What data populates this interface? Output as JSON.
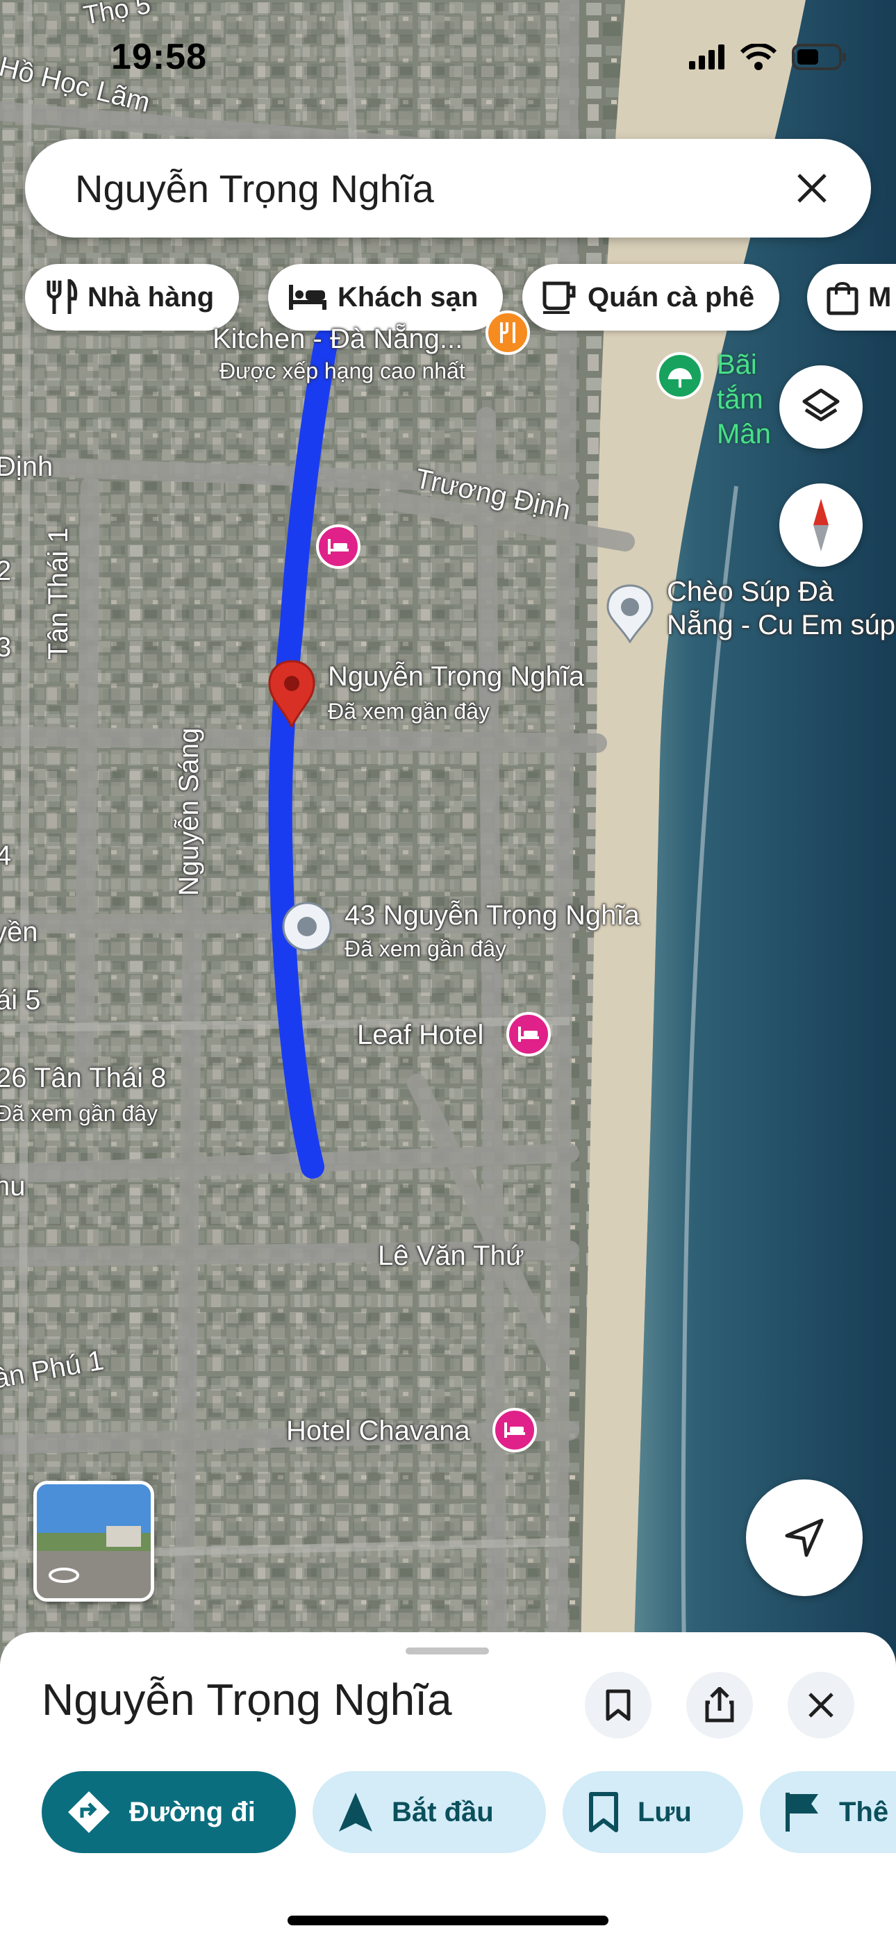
{
  "status_bar": {
    "time": "19:58"
  },
  "search": {
    "value": "Nguyễn Trọng Nghĩa",
    "clear_icon": "close-icon"
  },
  "chips": [
    {
      "label": "Nhà hàng",
      "icon": "restaurant-icon"
    },
    {
      "label": "Khách sạn",
      "icon": "hotel-icon"
    },
    {
      "label": "Quán cà phê",
      "icon": "coffee-icon"
    },
    {
      "label": "M",
      "icon": "shopping-bag-icon"
    }
  ],
  "map": {
    "street_labels": [
      "Trương Định",
      "Tân Thái 1",
      "Nguyễn Sáng",
      "Lê Văn Thứ",
      "26 Tân Thái 8",
      "Hồ Học Lãm",
      "Thọ 5",
      "Định",
      "yền",
      "ái 5",
      "hu",
      "ân Phú 1",
      "4",
      "3",
      "2"
    ],
    "places": [
      {
        "name": "Kitchen - Đà Nẵng...",
        "sub": "Được xếp hạng cao nhất",
        "icon": "restaurant-pin-icon"
      },
      {
        "name": "Bãi tắm Mân",
        "icon": "beach-pin-icon"
      },
      {
        "name": "Chèo Súp Đà Nẵng - Cu Em súp",
        "icon": "place-pin-icon"
      },
      {
        "name": "Nguyễn Trọng Nghĩa",
        "sub": "Đã xem gần đây",
        "icon": "red-location-pin-icon"
      },
      {
        "name": "43 Nguyễn Trọng Nghĩa",
        "sub": "Đã xem gần đây",
        "icon": "recent-place-pin-icon"
      },
      {
        "name": "Leaf Hotel",
        "icon": "hotel-pin-icon"
      },
      {
        "name": "Hotel Chavana",
        "icon": "hotel-pin-icon"
      },
      {
        "name": "",
        "sub": "Đã xem gần đây",
        "icon": "none"
      }
    ],
    "route_color": "#1a3cf0",
    "water_color": "#1e4a63",
    "sand_color": "#d8cfb8"
  },
  "sheet": {
    "title": "Nguyễn Trọng Nghĩa",
    "actions": [
      {
        "label": "Đường đi",
        "style": "primary",
        "icon": "directions-icon"
      },
      {
        "label": "Bắt đầu",
        "style": "secondary",
        "icon": "navigation-arrow-icon"
      },
      {
        "label": "Lưu",
        "style": "secondary",
        "icon": "bookmark-icon"
      },
      {
        "label": "Thê",
        "style": "secondary",
        "icon": "flag-icon"
      }
    ]
  },
  "colors": {
    "primary": "#0b6e7f",
    "secondary_bg": "#d3ecf7",
    "secondary_fg": "#0b4f5c",
    "pin_pink": "#e0218a",
    "pin_red": "#d93025"
  }
}
